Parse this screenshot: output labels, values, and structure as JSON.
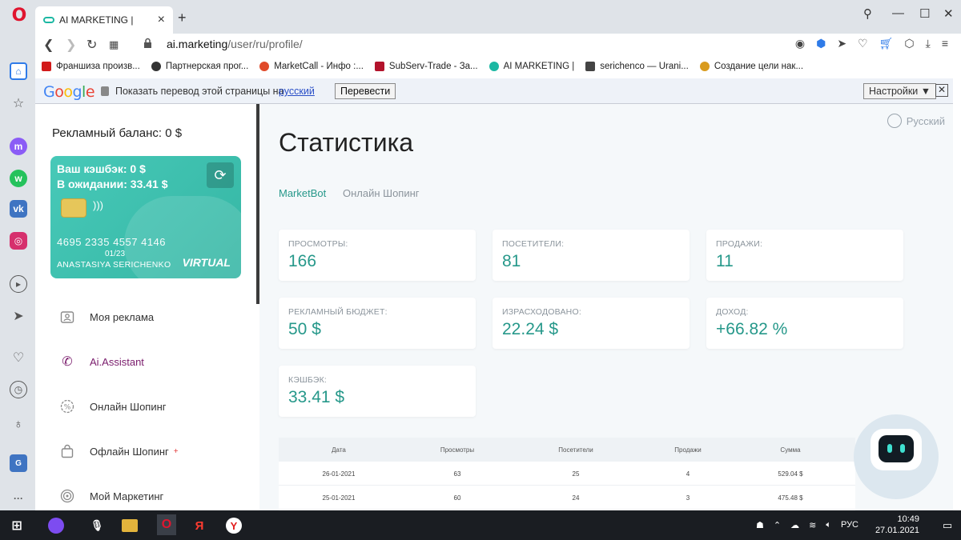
{
  "browser": {
    "tab_title": "AI MARKETING |",
    "url_host": "ai.marketing",
    "url_path": "/user/ru/profile/",
    "bookmarks": [
      "Франшиза произв...",
      "Партнерская прог...",
      "MarketCall - Инфо :...",
      "SubServ-Trade - За...",
      "AI MARKETING |",
      "serichenco — Urani...",
      "Создание цели нак..."
    ]
  },
  "translate_bar": {
    "logo": "Google",
    "prompt": "Показать перевод этой страницы на",
    "language": "русский",
    "translate_button": "Перевести",
    "settings_button": "Настройки ▼",
    "close": "✕"
  },
  "sidebar": {
    "balance": "Рекламный баланс: 0 $",
    "card": {
      "cashback": "Ваш кэшбэк: 0 $",
      "pending": "В ожидании: 33.41 $",
      "number": "4695 2335 4557 4146",
      "expiry": "01/23",
      "holder": "ANASTASIYA SERICHENKO",
      "brand": "VIRTUAL"
    },
    "menu": [
      {
        "label": "Моя реклама",
        "icon": "id-card-icon"
      },
      {
        "label": "Ai.Assistant",
        "icon": "phone-icon"
      },
      {
        "label": "Онлайн Шопинг",
        "icon": "percent-icon"
      },
      {
        "label": "Офлайн Шопинг",
        "icon": "shopping-bag-icon",
        "badge": "+"
      },
      {
        "label": "Мой Маркетинг",
        "icon": "target-icon"
      }
    ]
  },
  "main": {
    "title": "Статистика",
    "language": "Русский",
    "tabs": [
      "MarketBot",
      "Онлайн Шопинг"
    ],
    "stats": [
      {
        "label": "ПРОСМОТРЫ:",
        "value": "166"
      },
      {
        "label": "ПОСЕТИТЕЛИ:",
        "value": "81"
      },
      {
        "label": "ПРОДАЖИ:",
        "value": "11"
      },
      {
        "label": "РЕКЛАМНЫЙ БЮДЖЕТ:",
        "value": "50 $"
      },
      {
        "label": "ИЗРАСХОДОВАНО:",
        "value": "22.24 $"
      },
      {
        "label": "ДОХОД:",
        "value": "+66.82 %"
      },
      {
        "label": "КЭШБЭК:",
        "value": "33.41 $"
      }
    ],
    "table": {
      "headers": [
        "Дата",
        "Просмотры",
        "Посетители",
        "Продажи",
        "Сумма"
      ],
      "rows": [
        [
          "26-01-2021",
          "63",
          "25",
          "4",
          "529.04 $"
        ],
        [
          "25-01-2021",
          "60",
          "24",
          "3",
          "475.48 $"
        ]
      ]
    }
  },
  "taskbar": {
    "lang": "РУС",
    "time": "10:49",
    "date": "27.01.2021"
  },
  "colors": {
    "accent": "#26988a",
    "card": "#3fbfad",
    "active_menu": "#7a1c6c"
  }
}
